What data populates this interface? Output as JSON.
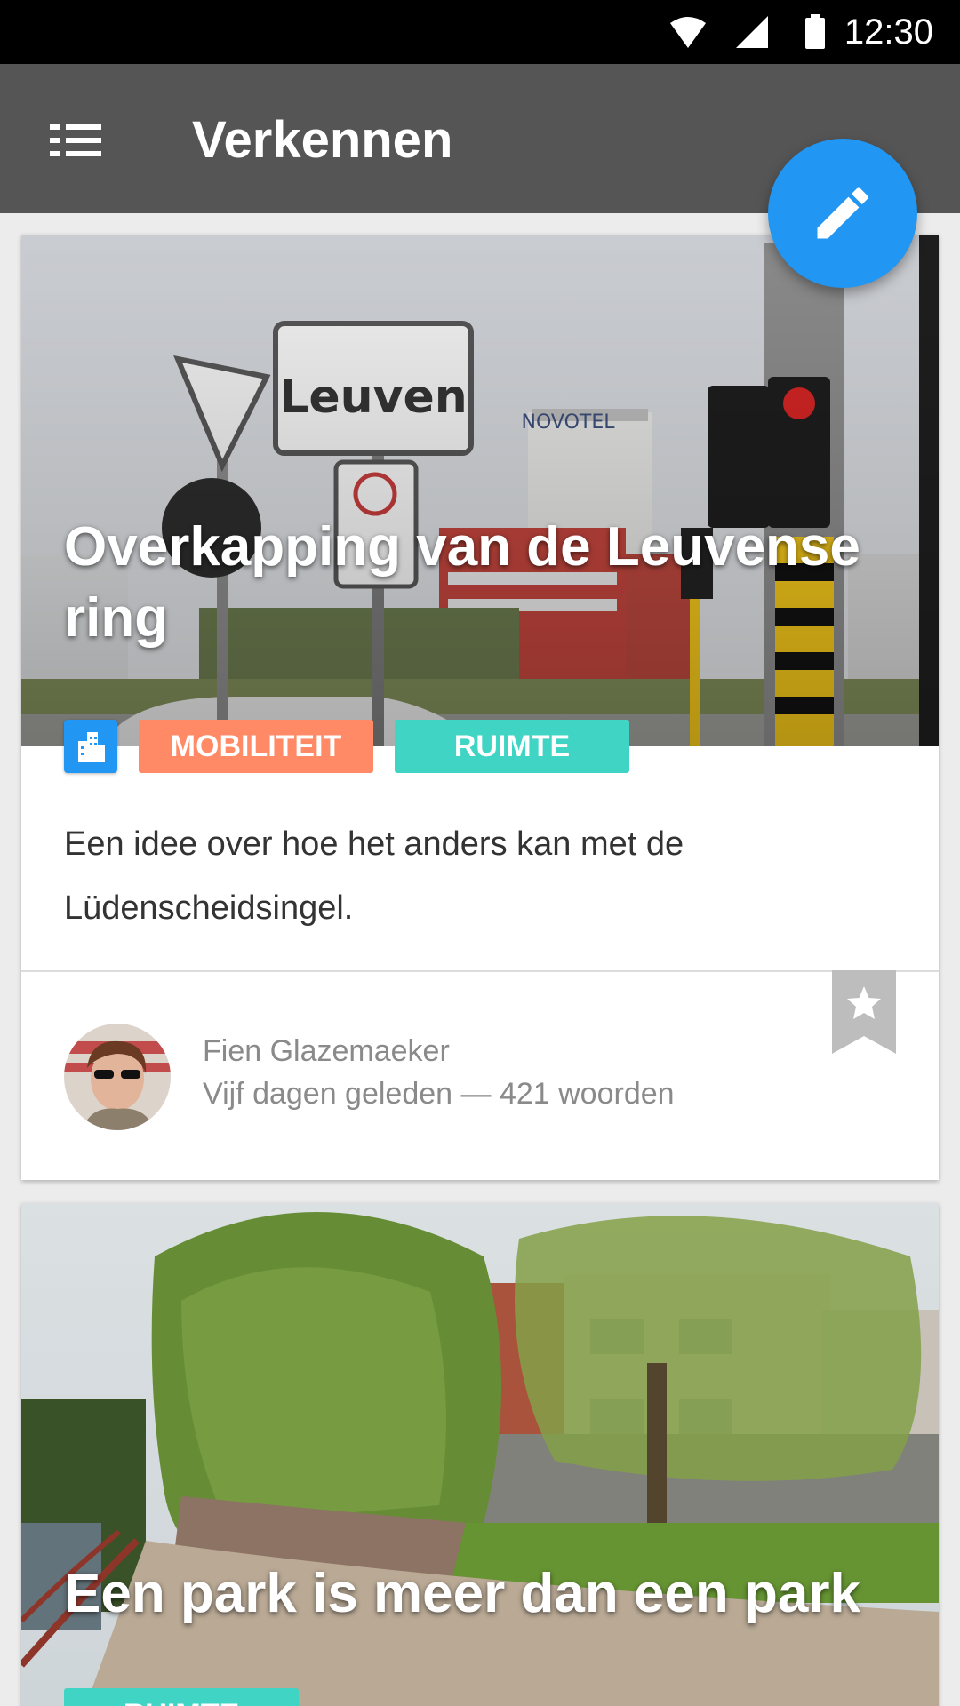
{
  "status_bar": {
    "time": "12:30",
    "icons": [
      "wifi-icon",
      "signal-icon",
      "battery-icon"
    ]
  },
  "app_bar": {
    "title": "Verkennen",
    "menu_icon": "list-menu-icon"
  },
  "fab": {
    "icon": "pencil-icon",
    "color": "#2196f3"
  },
  "cards": [
    {
      "title": "Overkapping van de Leuvense ring",
      "category_icon": "city-buildings-icon",
      "tags": [
        {
          "label": "MOBILITEIT",
          "color": "#ff8a65"
        },
        {
          "label": "RUIMTE",
          "color": "#40d4c4"
        }
      ],
      "description": "Een idee over hoe het anders kan met de Lüdenscheidsingel.",
      "author": "Fien Glazemaeker",
      "meta": "Vijf dagen geleden — 421 woorden",
      "bookmark_icon": "star-bookmark-icon"
    },
    {
      "title": "Een park is meer dan een park",
      "tags": [
        {
          "label": "RUIMTE",
          "color": "#40d4c4"
        }
      ]
    }
  ]
}
